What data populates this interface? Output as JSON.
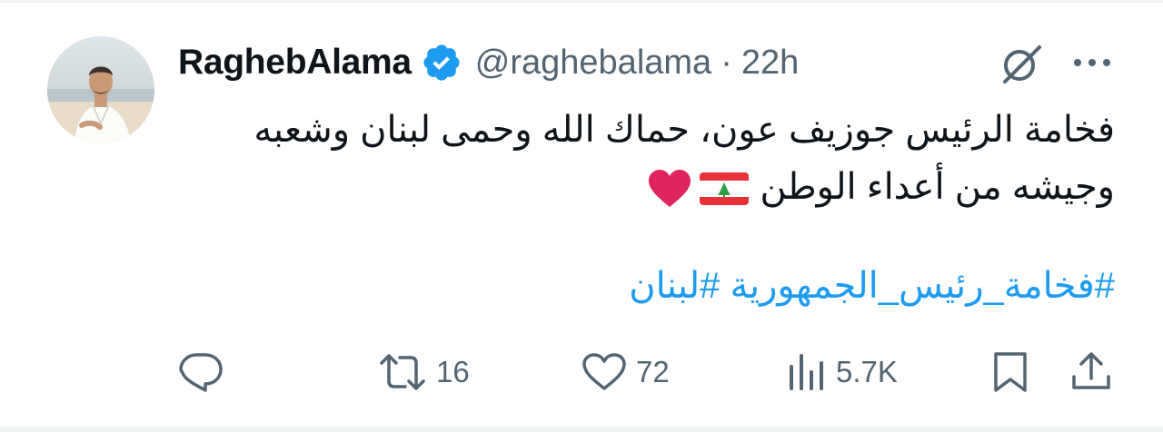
{
  "author": {
    "display_name": "RaghebAlama",
    "handle": "@raghebalama",
    "separator": "·",
    "time": "22h",
    "verified": true
  },
  "tweet": {
    "lines": [
      "فخامة الرئيس جوزيف عون، حماك الله وحمى لبنان وشعبه",
      "وجيشه من أعداء الوطن"
    ],
    "emojis": [
      "lebanon-flag",
      "red-heart"
    ],
    "hashtags": [
      "#فخامة_رئيس_الجمهورية",
      "#لبنان"
    ]
  },
  "actions": {
    "reply_count": "",
    "retweet_count": "16",
    "like_count": "72",
    "views_count": "5.7K"
  },
  "colors": {
    "text": "#0f1419",
    "secondary": "#536471",
    "link": "#1d9bf0",
    "verified": "#1d9bf0",
    "heart": "#e0245e"
  },
  "icons": [
    "verified-badge-icon",
    "grok-icon",
    "more-icon",
    "reply-icon",
    "retweet-icon",
    "like-icon",
    "views-icon",
    "bookmark-icon",
    "share-icon"
  ]
}
